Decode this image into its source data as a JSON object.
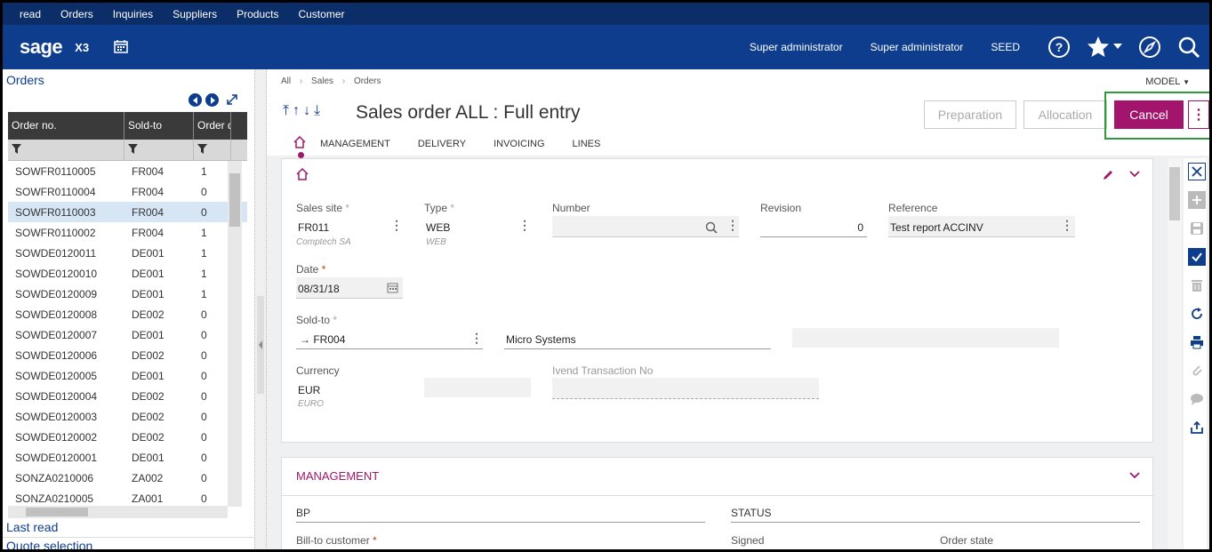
{
  "topnav": {
    "items": [
      "read",
      "Orders",
      "Inquiries",
      "Suppliers",
      "Products",
      "Customer"
    ]
  },
  "header": {
    "logo": "sage",
    "product": "X3",
    "user1": "Super administrator",
    "user2": "Super administrator",
    "folder": "SEED"
  },
  "left": {
    "title": "Orders",
    "columns": [
      "Order no.",
      "Sold-to",
      "Order d"
    ],
    "rows": [
      {
        "no": "SOWFR0110005",
        "sold": "FR004",
        "d": "1"
      },
      {
        "no": "SOWFR0110004",
        "sold": "FR004",
        "d": "0"
      },
      {
        "no": "SOWFR0110003",
        "sold": "FR004",
        "d": "0"
      },
      {
        "no": "SOWFR0110002",
        "sold": "FR004",
        "d": "1"
      },
      {
        "no": "SOWDE0120011",
        "sold": "DE001",
        "d": "1"
      },
      {
        "no": "SOWDE0120010",
        "sold": "DE001",
        "d": "1"
      },
      {
        "no": "SOWDE0120009",
        "sold": "DE001",
        "d": "1"
      },
      {
        "no": "SOWDE0120008",
        "sold": "DE002",
        "d": "0"
      },
      {
        "no": "SOWDE0120007",
        "sold": "DE001",
        "d": "0"
      },
      {
        "no": "SOWDE0120006",
        "sold": "DE002",
        "d": "0"
      },
      {
        "no": "SOWDE0120005",
        "sold": "DE001",
        "d": "0"
      },
      {
        "no": "SOWDE0120004",
        "sold": "DE002",
        "d": "0"
      },
      {
        "no": "SOWDE0120003",
        "sold": "DE002",
        "d": "0"
      },
      {
        "no": "SOWDE0120002",
        "sold": "DE002",
        "d": "0"
      },
      {
        "no": "SOWDE0120001",
        "sold": "DE001",
        "d": "0"
      },
      {
        "no": "SONZA0210006",
        "sold": "ZA002",
        "d": "0"
      },
      {
        "no": "SONZA0210005",
        "sold": "ZA001",
        "d": "0"
      }
    ],
    "last_read": "Last read",
    "quote": "Quote selection"
  },
  "main": {
    "breadcrumb": [
      "All",
      "Sales",
      "Orders"
    ],
    "model": "MODEL",
    "title": "Sales order ALL : Full entry",
    "tabs": [
      "MANAGEMENT",
      "DELIVERY",
      "INVOICING",
      "LINES"
    ],
    "btn_prep": "Preparation",
    "btn_alloc": "Allocation",
    "btn_cancel": "Cancel",
    "form": {
      "sales_site_label": "Sales site",
      "sales_site": "FR011",
      "sales_site_sub": "Comptech SA",
      "type_label": "Type",
      "type": "WEB",
      "type_sub": "WEB",
      "number_label": "Number",
      "revision_label": "Revision",
      "revision": "0",
      "reference_label": "Reference",
      "reference": "Test report ACCINV",
      "date_label": "Date",
      "date": "08/31/18",
      "soldto_label": "Sold-to",
      "soldto": "FR004",
      "soldto_name": "Micro Systems",
      "currency_label": "Currency",
      "currency": "EUR",
      "currency_sub": "EURO",
      "ivend_label": "Ivend Transaction No"
    },
    "management": {
      "title": "MANAGEMENT",
      "bp": "BP",
      "status": "STATUS",
      "bill_to": "Bill-to customer",
      "signed": "Signed",
      "order_state": "Order state"
    }
  },
  "colors": {
    "accent": "#a3146d",
    "nav": "#0d3d8c",
    "topnav": "#0b2e68",
    "highlight": "#2e9a3c"
  }
}
